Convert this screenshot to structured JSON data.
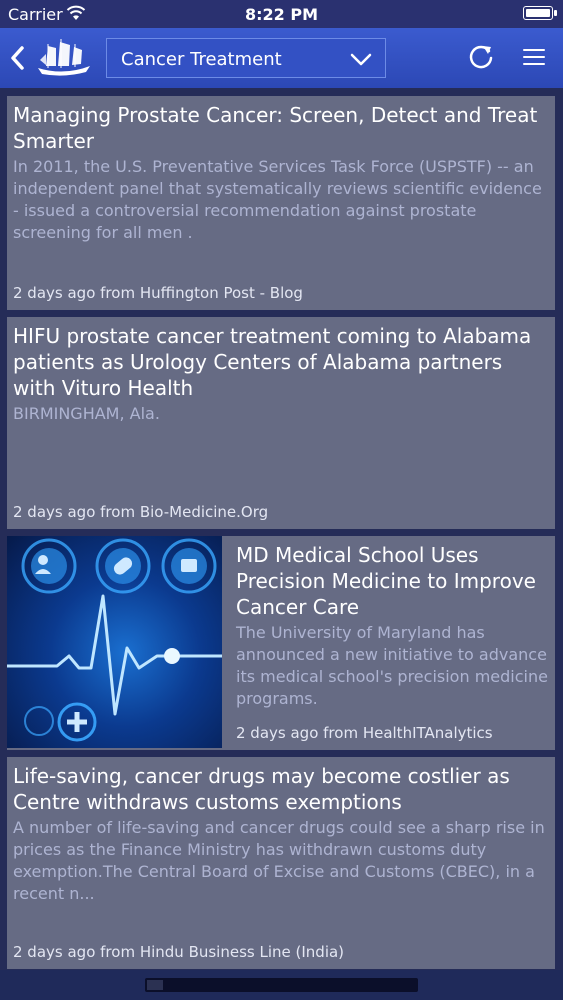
{
  "status_bar": {
    "carrier": "Carrier",
    "time": "8:22 PM"
  },
  "nav": {
    "category": "Cancer Treatment"
  },
  "articles": [
    {
      "title": "Managing Prostate Cancer: Screen, Detect and Treat Smarter",
      "summary": "In 2011, the U.S. Preventative Services Task Force (USPSTF) -- an independent panel that systematically reviews scientific evidence - issued a controversial recommendation against prostate screening for all men .",
      "meta": "2 days ago from Huffington Post - Blog"
    },
    {
      "title": "HIFU prostate cancer treatment coming to Alabama patients as Urology Centers of Alabama partners with Vituro Health",
      "summary": "BIRMINGHAM, Ala.",
      "meta": "2 days ago from Bio-Medicine.Org"
    },
    {
      "title": "MD Medical School Uses Precision Medicine to Improve Cancer Care",
      "summary": "The University of Maryland has announced a new initiative to advance its medical school's precision medicine programs.",
      "meta": "2 days ago from HealthITAnalytics"
    },
    {
      "title": "Life-saving, cancer drugs may become costlier as Centre withdraws customs exemptions",
      "summary": "A number of life-saving and cancer drugs could see a sharp rise in prices as the Finance Ministry has withdrawn customs duty exemption.The Central Board of Excise and Customs (CBEC), in a recent n...",
      "meta": "2 days ago from Hindu Business Line (India)"
    }
  ]
}
